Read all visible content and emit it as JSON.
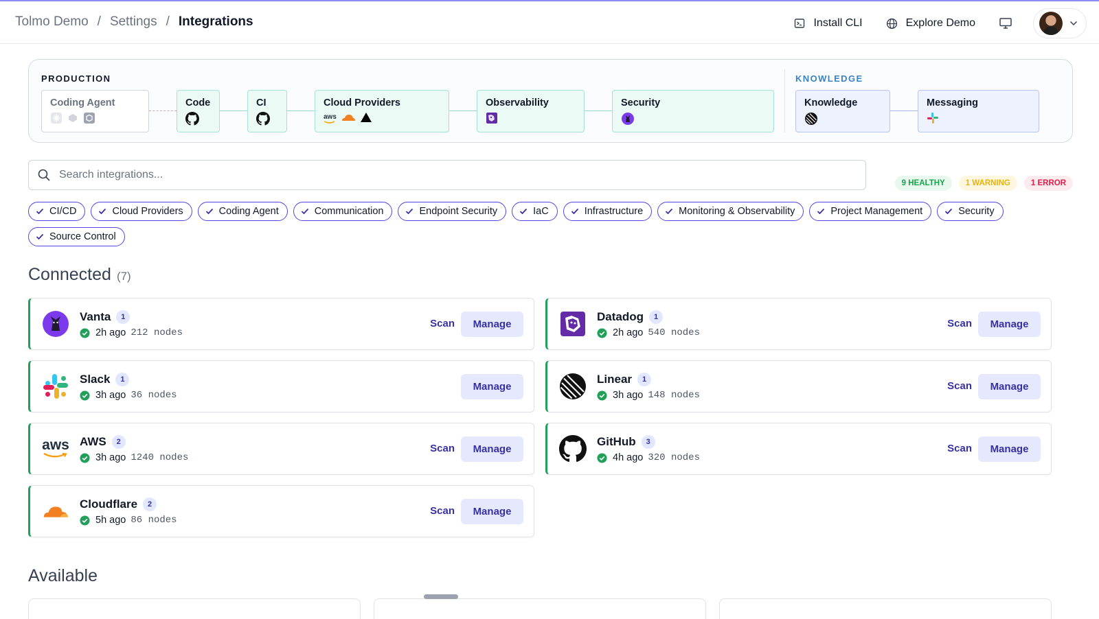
{
  "breadcrumb": {
    "items": [
      "Tolmo Demo",
      "Settings",
      "Integrations"
    ]
  },
  "header": {
    "install_cli": "Install CLI",
    "explore_demo": "Explore Demo"
  },
  "pipeline": {
    "production_label": "PRODUCTION",
    "knowledge_label": "KNOWLEDGE",
    "nodes": {
      "coding_agent": "Coding Agent",
      "code": "Code",
      "ci": "CI",
      "cloud_providers": "Cloud Providers",
      "observability": "Observability",
      "security": "Security",
      "knowledge": "Knowledge",
      "messaging": "Messaging"
    },
    "aws_text": "aws",
    "colors": {
      "production": "#111827",
      "knowledge": "#3b82c4"
    }
  },
  "search": {
    "placeholder": "Search integrations...",
    "value": ""
  },
  "status_badges": {
    "healthy": "9 HEALTHY",
    "warning": "1 WARNING",
    "error": "1 ERROR"
  },
  "filters": [
    "CI/CD",
    "Cloud Providers",
    "Coding Agent",
    "Communication",
    "Endpoint Security",
    "IaC",
    "Infrastructure",
    "Monitoring & Observability",
    "Project Management",
    "Security",
    "Source Control"
  ],
  "connected": {
    "title": "Connected",
    "count": "(7)",
    "scan_label": "Scan",
    "manage_label": "Manage",
    "items": [
      {
        "name": "Vanta",
        "badge": "1",
        "time": "2h ago",
        "nodes": "212 nodes",
        "icon": "vanta-logo",
        "has_scan": true
      },
      {
        "name": "Datadog",
        "badge": "1",
        "time": "2h ago",
        "nodes": "540 nodes",
        "icon": "datadog-logo",
        "has_scan": true
      },
      {
        "name": "Slack",
        "badge": "1",
        "time": "3h ago",
        "nodes": "36 nodes",
        "icon": "slack-logo",
        "has_scan": false
      },
      {
        "name": "Linear",
        "badge": "1",
        "time": "3h ago",
        "nodes": "148 nodes",
        "icon": "linear-logo",
        "has_scan": true
      },
      {
        "name": "AWS",
        "badge": "2",
        "time": "3h ago",
        "nodes": "1240 nodes",
        "icon": "aws-logo",
        "has_scan": true
      },
      {
        "name": "GitHub",
        "badge": "3",
        "time": "4h ago",
        "nodes": "320 nodes",
        "icon": "github-logo",
        "has_scan": true
      },
      {
        "name": "Cloudflare",
        "badge": "2",
        "time": "5h ago",
        "nodes": "86 nodes",
        "icon": "cloudflare-logo",
        "has_scan": true
      }
    ]
  },
  "available": {
    "title": "Available"
  }
}
